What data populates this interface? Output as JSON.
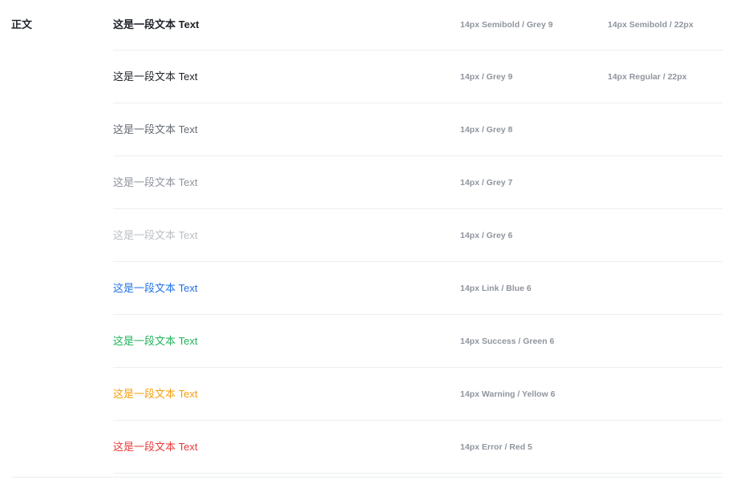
{
  "section": {
    "title": "正文"
  },
  "rows": [
    {
      "sample": "这是一段文本 Text",
      "color": "#1f2329",
      "weight": "bold",
      "spec": "14px Semibold / Grey 9",
      "spec2": "14px Semibold / 22px"
    },
    {
      "sample": "这是一段文本 Text",
      "color": "#1f2329",
      "weight": "regular",
      "spec": "14px / Grey 9",
      "spec2": "14px Regular / 22px"
    },
    {
      "sample": "这是一段文本 Text",
      "color": "#646a73",
      "weight": "regular",
      "spec": "14px / Grey 8",
      "spec2": ""
    },
    {
      "sample": "这是一段文本 Text",
      "color": "#8f959e",
      "weight": "regular",
      "spec": "14px / Grey 7",
      "spec2": ""
    },
    {
      "sample": "这是一段文本 Text",
      "color": "#bbbfc4",
      "weight": "regular",
      "spec": "14px / Grey 6",
      "spec2": ""
    },
    {
      "sample": "这是一段文本 Text",
      "color": "#1f72e8",
      "weight": "regular",
      "spec": "14px Link / Blue 6",
      "spec2": ""
    },
    {
      "sample": "这是一段文本 Text",
      "color": "#1fb45a",
      "weight": "regular",
      "spec": "14px Success / Green 6",
      "spec2": ""
    },
    {
      "sample": "这是一段文本 Text",
      "color": "#f5a00c",
      "weight": "regular",
      "spec": "14px Warning / Yellow 6",
      "spec2": ""
    },
    {
      "sample": "这是一段文本 Text",
      "color": "#e83a3a",
      "weight": "regular",
      "spec": "14px Error / Red 5",
      "spec2": ""
    }
  ]
}
